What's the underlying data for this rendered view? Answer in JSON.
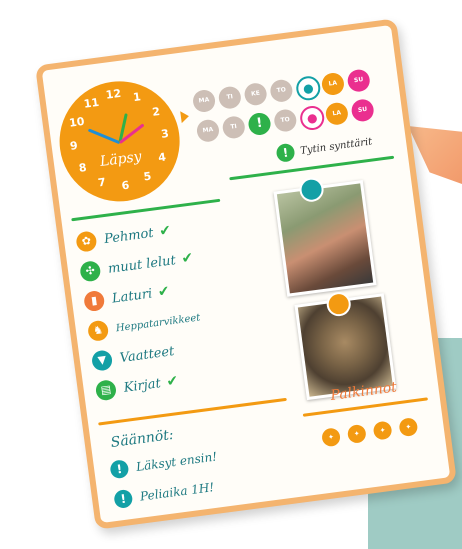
{
  "clock": {
    "name": "Läpsy",
    "numbers": [
      "12",
      "1",
      "2",
      "3",
      "4",
      "5",
      "6",
      "7",
      "8",
      "9",
      "10",
      "11"
    ]
  },
  "week_row1": [
    "MA",
    "TI",
    "KE",
    "TO",
    "",
    "LA",
    "SU"
  ],
  "week_row2": [
    "MA",
    "TI",
    "!",
    "TO",
    "",
    "LA",
    "SU"
  ],
  "birthday_note": "Tytin synttärit",
  "items": [
    {
      "label": "Pehmot",
      "icon": "teddy-icon",
      "done": true,
      "color": "#f39a12"
    },
    {
      "label": "muut lelut",
      "icon": "pinwheel-icon",
      "done": true,
      "color": "#2eb14a"
    },
    {
      "label": "Laturi",
      "icon": "charger-icon",
      "done": true,
      "color": "#f07a3a"
    },
    {
      "label": "Heppatarvikkeet",
      "icon": "horse-icon",
      "done": false,
      "color": "#f39a12"
    },
    {
      "label": "Vaatteet",
      "icon": "shirt-icon",
      "done": false,
      "color": "#13a0a6"
    },
    {
      "label": "Kirjat",
      "icon": "book-icon",
      "done": true,
      "color": "#2eb14a"
    }
  ],
  "rules_title": "Säännöt:",
  "rules": [
    "Läksyt ensin!",
    "Peliaika 1H!"
  ],
  "rewards_title": "Palkinnot",
  "colors": {
    "frame": "#f4b46f",
    "orange": "#f39a12",
    "green": "#2eb14a",
    "teal": "#13a0a6",
    "pink": "#ea2f8f"
  }
}
